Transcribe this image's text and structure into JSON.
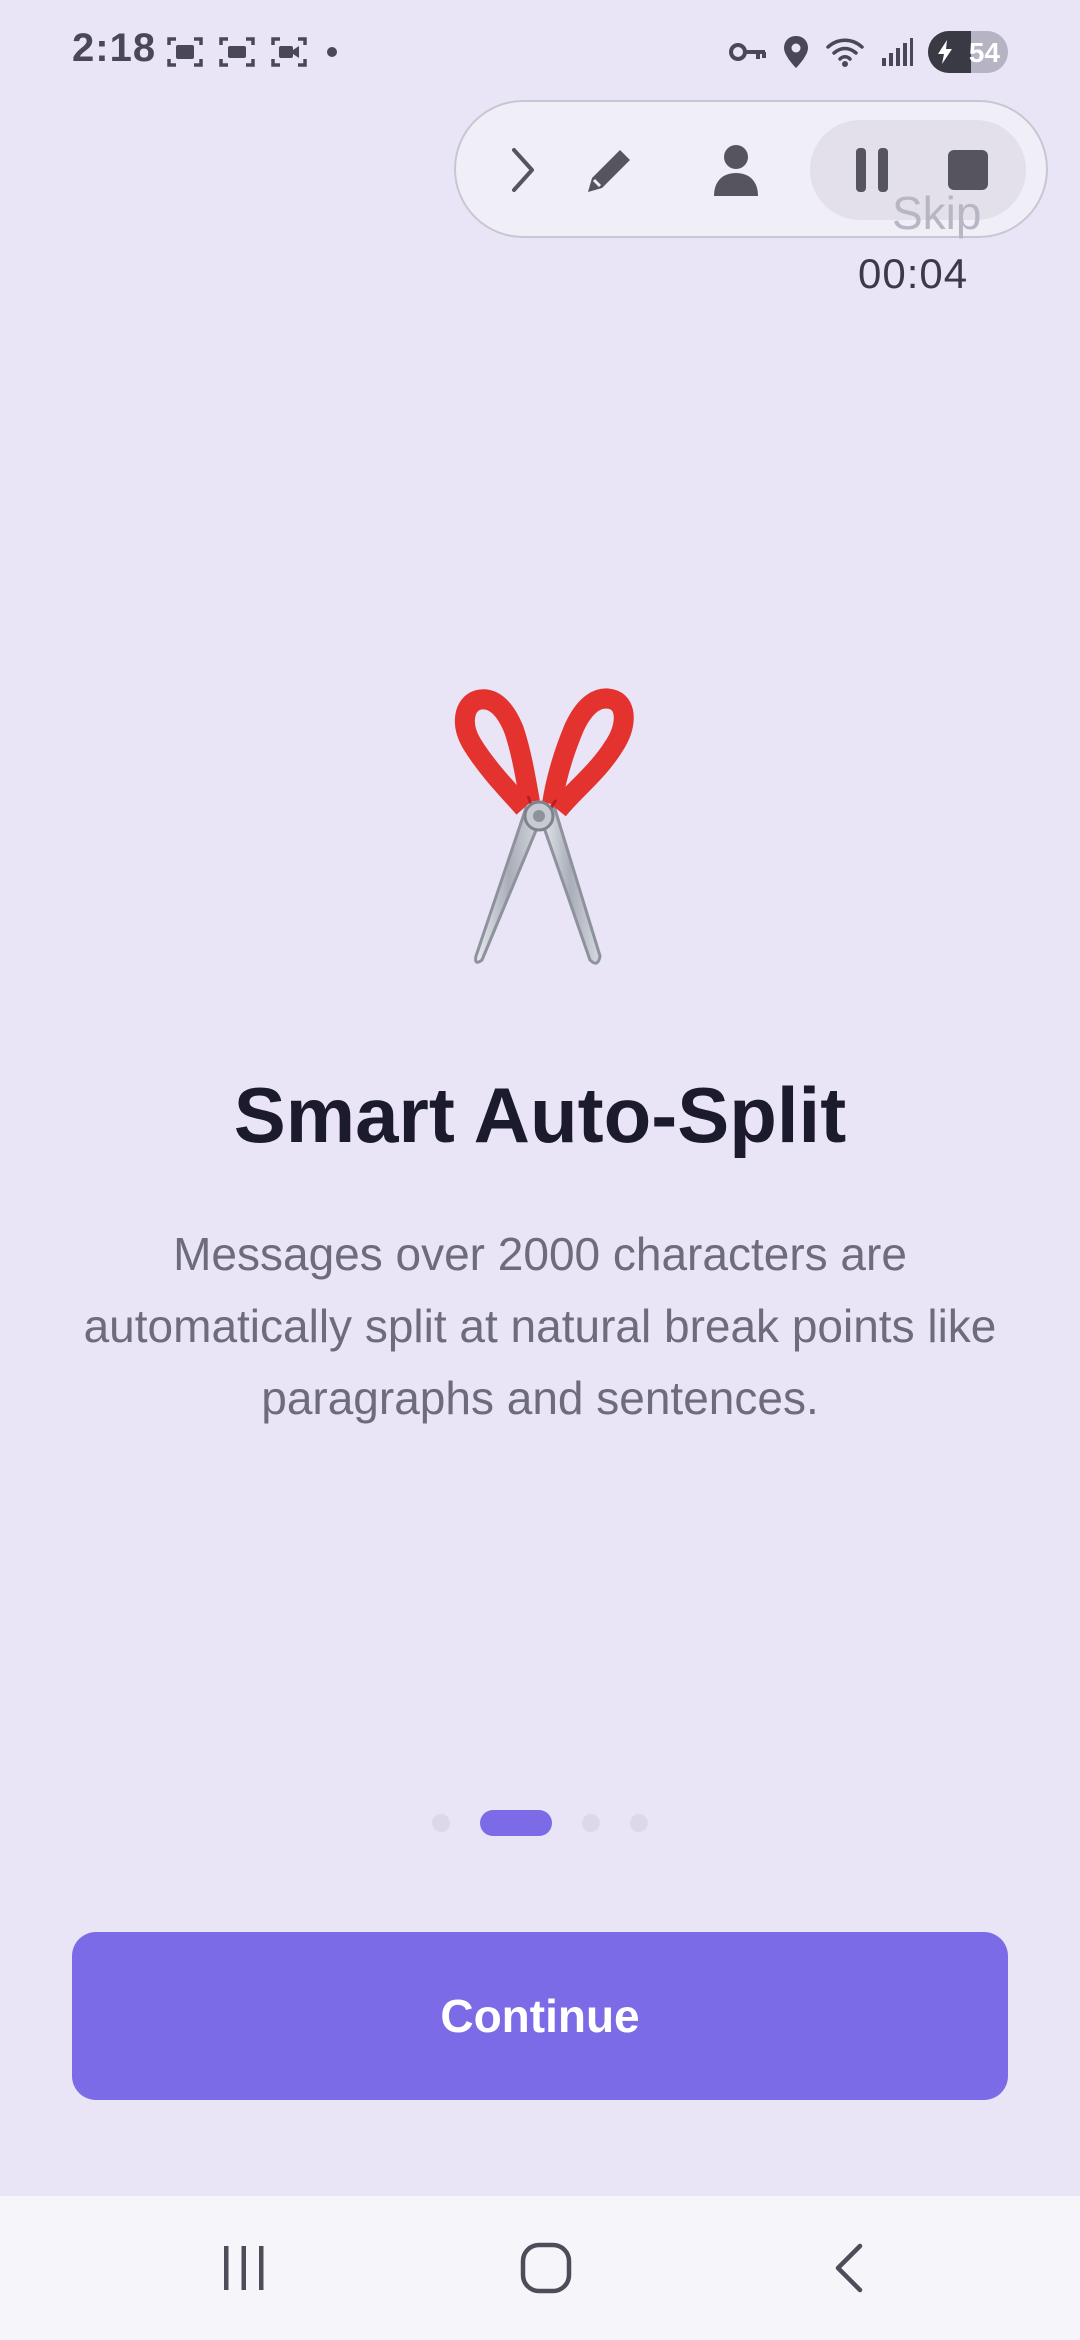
{
  "status_bar": {
    "time": "2:18",
    "battery_level": 54,
    "battery_text": "54",
    "icons_left": [
      "screenshot-icon",
      "screen-capture-icon",
      "screen-record-icon",
      "notification-dot-icon"
    ],
    "icons_right": [
      "vpn-key-icon",
      "location-icon",
      "wifi-icon",
      "signal-icon",
      "battery-icon"
    ]
  },
  "recorder": {
    "buttons": [
      "expand-chevron-icon",
      "pen-icon",
      "person-icon",
      "pause-icon",
      "stop-icon"
    ],
    "timer": "00:04"
  },
  "onboarding": {
    "skip_label": "Skip",
    "hero_icon": "scissors-icon",
    "title": "Smart Auto-Split",
    "description": "Messages over 2000 characters are automatically split at natural break points like paragraphs and sentences.",
    "page_count": 4,
    "current_page": 2,
    "continue_label": "Continue"
  },
  "nav_bar": {
    "buttons": [
      "recents-icon",
      "home-icon",
      "back-icon"
    ]
  },
  "colors": {
    "background": "#e9e5f7",
    "accent": "#7b6be6",
    "title": "#1c1b2e",
    "body_text": "#6e6c7c"
  }
}
